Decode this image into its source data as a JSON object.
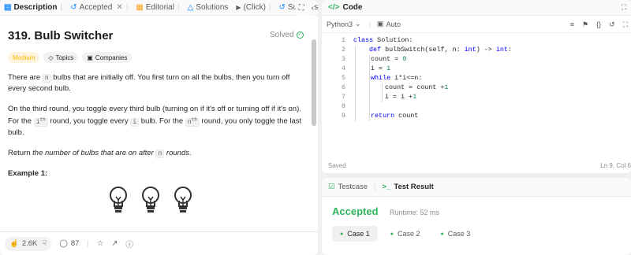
{
  "left_tabs": [
    {
      "label": "Description",
      "icon": "document-icon"
    },
    {
      "label": "Accepted",
      "icon": "history-icon"
    },
    {
      "label": "Editorial",
      "icon": "book-icon"
    },
    {
      "label": "Solutions",
      "icon": "flask-icon"
    },
    {
      "label": "(Click)",
      "icon": "play-icon"
    },
    {
      "label": "Submissio",
      "icon": "submissions-icon"
    }
  ],
  "problem": {
    "title": "319. Bulb Switcher",
    "status": "Solved",
    "difficulty": "Medium",
    "topics_label": "Topics",
    "companies_label": "Companies",
    "p1_a": "There are ",
    "p1_code": "n",
    "p1_b": " bulbs that are initially off. You first turn on all the bulbs, then you turn off every second bulb.",
    "p2_a": "On the third round, you toggle every third bulb (turning on if it's off or turning off if it's on). For the ",
    "p2_code1": "i",
    "p2_sup1": "th",
    "p2_b": " round, you toggle every ",
    "p2_code2": "i",
    "p2_c": " bulb. For the ",
    "p2_code3": "n",
    "p2_sup2": "th",
    "p2_d": " round, you only toggle the last bulb.",
    "p3_a": "Return ",
    "p3_em": "the number of bulbs that are on after ",
    "p3_code": "n",
    "p3_em2": " rounds",
    "p3_b": ".",
    "example_label": "Example 1:"
  },
  "bottom_bar": {
    "likes": "2.6K",
    "comments": "87"
  },
  "code_panel": {
    "title": "Code",
    "language": "Python3",
    "mode": "Auto",
    "saved": "Saved",
    "cursor": "Ln 9, Col 6",
    "line_numbers": [
      "1",
      "2",
      "3",
      "4",
      "5",
      "6",
      "7",
      "8",
      "9"
    ]
  },
  "result_panel": {
    "tab_testcase": "Testcase",
    "tab_result": "Test Result",
    "verdict": "Accepted",
    "runtime": "Runtime: 52 ms",
    "cases": [
      "Case 1",
      "Case 2",
      "Case 3"
    ]
  },
  "colors": {
    "accent_green": "#2db55d",
    "medium_orange": "#ffb800",
    "keyword_blue": "#0000ff",
    "number_green": "#098658"
  }
}
